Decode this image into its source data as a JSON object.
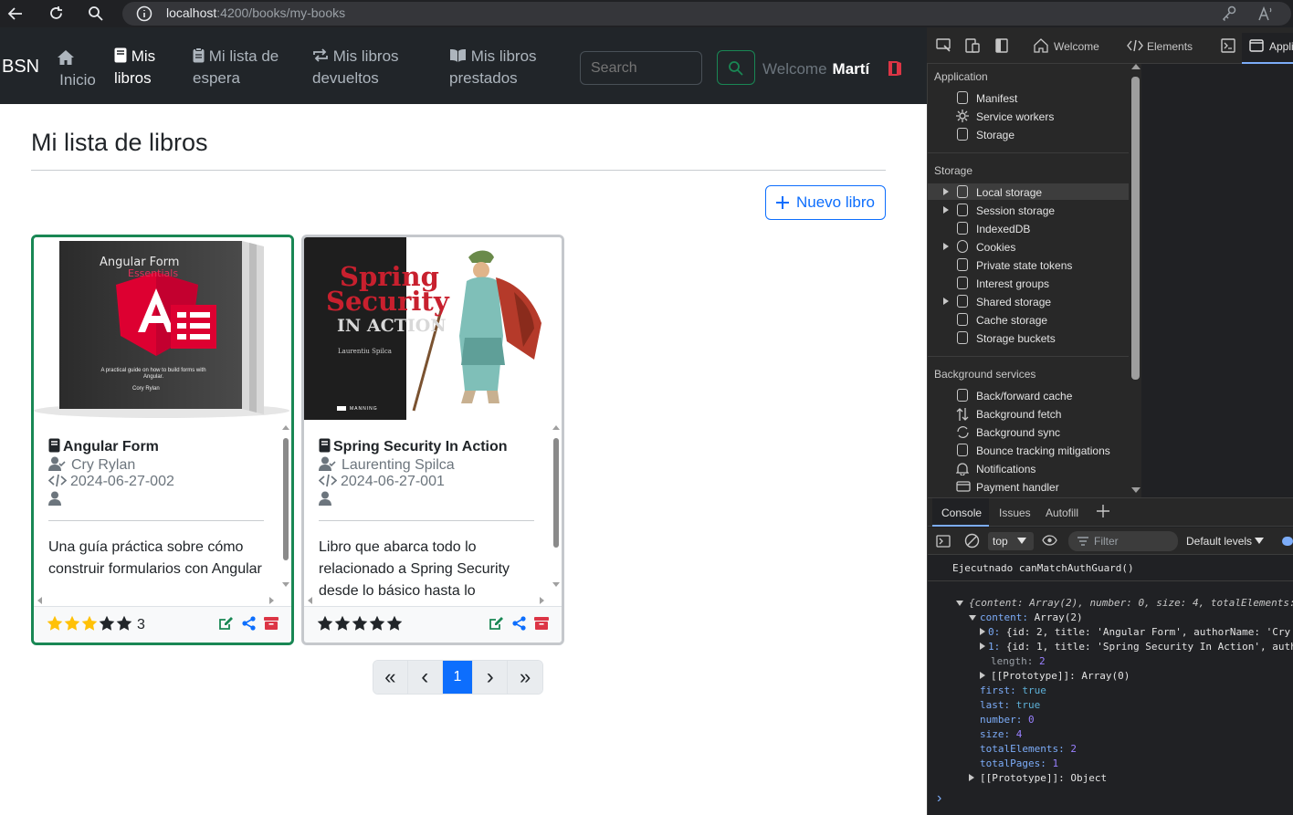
{
  "browser": {
    "url_host": "localhost",
    "url_rest": ":4200/books/my-books",
    "icons": [
      "back-arrow-icon",
      "refresh-icon",
      "search-icon",
      "info-icon",
      "key-icon",
      "read-aloud-icon"
    ]
  },
  "navbar": {
    "brand": "BSN",
    "items": [
      {
        "label1": "Inicio",
        "icon": "home-icon"
      },
      {
        "label1": "Mis",
        "label2": "libros",
        "icon": "book-icon",
        "active": true
      },
      {
        "label1": "Mi lista de",
        "label2": "espera",
        "icon": "clipboard-icon"
      },
      {
        "label1": "Mis libros",
        "label2": "devueltos",
        "icon": "repeat-icon"
      },
      {
        "label1": "Mis libros",
        "label2": "prestados",
        "icon": "open-book-icon"
      }
    ],
    "search_placeholder": "Search",
    "welcome": "Welcome",
    "user": "Martí"
  },
  "page": {
    "title": "Mi lista de libros",
    "new_book": "Nuevo libro"
  },
  "books": [
    {
      "title": "Angular Form",
      "author": "Cry Rylan",
      "isbn": "2024-06-27-002",
      "description": "Una guía práctica sobre cómo construir formularios con Angular",
      "rating": 3,
      "rating_label": "3",
      "cover": {
        "title": "Angular Form",
        "subtitle": "Essentials",
        "tagline": "A practical guide on how to build forms with Angular.",
        "author": "Cory Rylan"
      }
    },
    {
      "title": "Spring Security In Action",
      "author": "Laurenting Spilca",
      "isbn": "2024-06-27-001",
      "description": "Libro que abarca todo lo relacionado a Spring Security desde lo básico hasta lo",
      "rating": 0,
      "rating_label": "",
      "cover": {
        "title1": "Spring",
        "title2": "Security",
        "title3": "IN ACTION",
        "author": "Laurentiu Spilca",
        "publisher": "MANNING"
      }
    }
  ],
  "pagination": {
    "first": "«",
    "prev": "‹",
    "current": "1",
    "next": "›",
    "last": "»"
  },
  "devtools": {
    "tabs": [
      "Welcome",
      "Elements",
      "Appli"
    ],
    "sections": {
      "application": {
        "title": "Application",
        "items": [
          "Manifest",
          "Service workers",
          "Storage"
        ]
      },
      "storage": {
        "title": "Storage",
        "items": [
          "Local storage",
          "Session storage",
          "IndexedDB",
          "Cookies",
          "Private state tokens",
          "Interest groups",
          "Shared storage",
          "Cache storage",
          "Storage buckets"
        ]
      },
      "background": {
        "title": "Background services",
        "items": [
          "Back/forward cache",
          "Background fetch",
          "Background sync",
          "Bounce tracking mitigations",
          "Notifications",
          "Payment handler"
        ]
      }
    },
    "console_tabs": [
      "Console",
      "Issues",
      "Autofill"
    ],
    "context": "top",
    "filter_placeholder": "Filter",
    "levels": "Default levels",
    "log_message": "Ejecutnado canMatchAuthGuard()",
    "log_object": {
      "summary_key": "{content:",
      "summary": " Array(2), number: 0, size: 4, totalElements:",
      "content_label": "content:",
      "content_value": "Array(2)",
      "row0_label": "0:",
      "row0_value": "{id: 2, title: 'Angular Form', authorName: 'Cry",
      "row1_label": "1:",
      "row1_value": "{id: 1, title: 'Spring Security In Action', auth",
      "length_label": "length:",
      "length_value": "2",
      "proto1_label": "[[Prototype]]:",
      "proto1_value": "Array(0)",
      "first_label": "first:",
      "first_value": "true",
      "last_label": "last:",
      "last_value": "true",
      "number_label": "number:",
      "number_value": "0",
      "size_label": "size:",
      "size_value": "4",
      "total_el_label": "totalElements:",
      "total_el_value": "2",
      "total_pages_label": "totalPages:",
      "total_pages_value": "1",
      "proto2_label": "[[Prototype]]:",
      "proto2_value": "Object"
    },
    "prompt": "›"
  }
}
